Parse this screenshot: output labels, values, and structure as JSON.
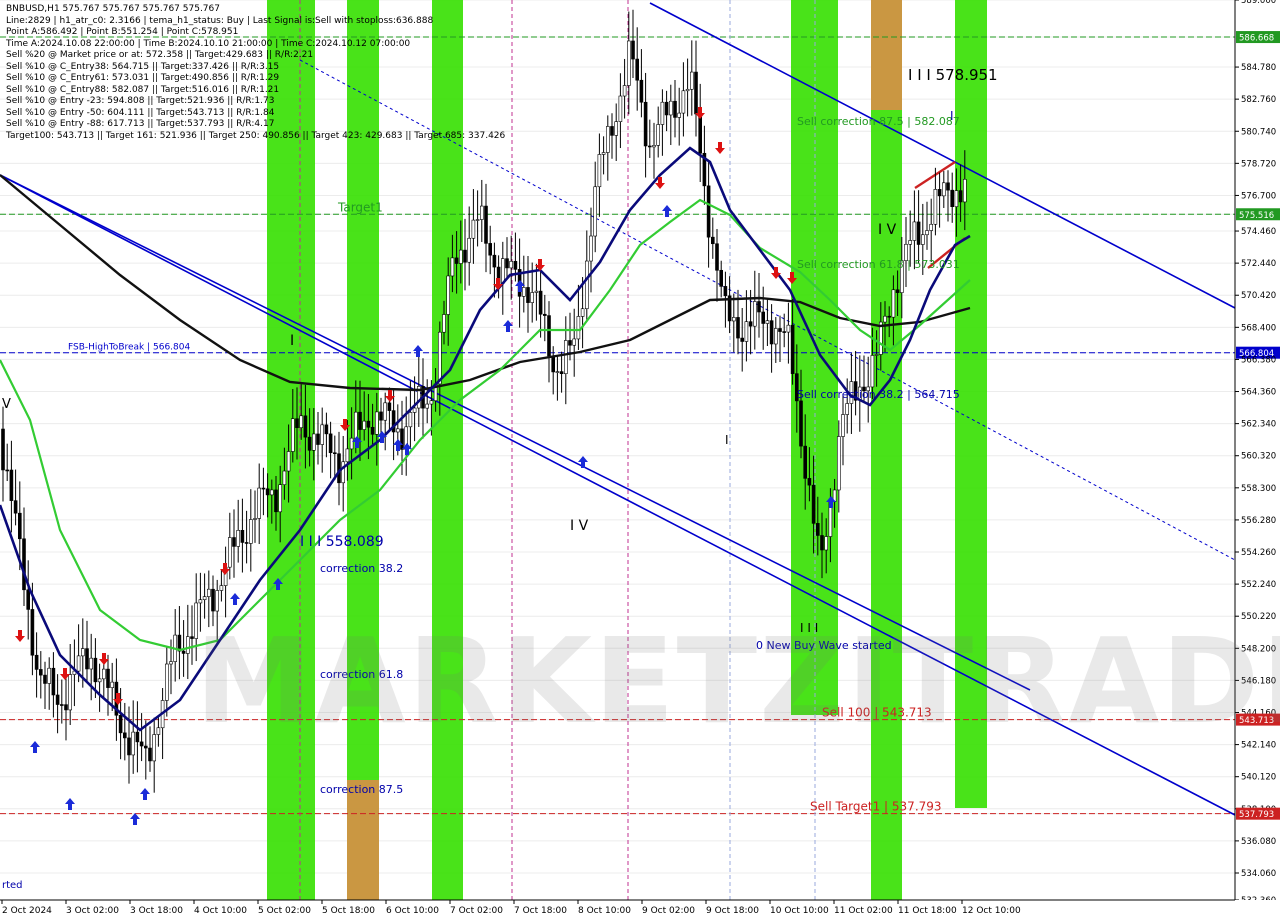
{
  "info_lines": [
    "BNBUSD,H1  575.767 575.767 575.767 575.767",
    "Line:2829  |  h1_atr_c0: 2.3166  |  tema_h1_status: Buy  |  Last Signal is:Sell with stoploss:636.888",
    "Point A:586.492  |  Point B:551.254  |  Point C:578.951",
    "Time A:2024.10.08 22:00:00  |  Time B:2024.10.10 21:00:00  |  Time C:2024.10.12 07:00:00",
    "Sell %20 @ Market price or at: 572.358  ||  Target:429.683  ||  R/R:2.21",
    "Sell %10 @ C_Entry38: 564.715  ||  Target:337.426  ||  R/R:3.15",
    "Sell %10 @ C_Entry61: 573.031  ||  Target:490.856  ||  R/R:1.29",
    "Sell %10 @ C_Entry88: 582.087  ||  Target:516.016  ||  R/R:1.21",
    "Sell %10 @ Entry -23: 594.808  ||  Target:521.936  ||  R/R:1.73",
    "Sell %10 @ Entry -50: 604.111  ||  Target:543.713  ||  R/R:1.84",
    "Sell %10 @ Entry -88: 617.713  ||  Target:537.793  ||  R/R:4.17",
    "Target100: 543.713  ||  Target 161: 521.936  ||  Target 250: 490.856  ||  Target 423: 429.683  ||  Target 685: 337.426"
  ],
  "watermark": "MARKETZITRADE",
  "colors": {
    "green_band": "#35e000",
    "orange_band": "#e08a4a",
    "blue_line": "#0000cc",
    "navy_ma": "#0a0a7a",
    "green_ma": "#33cc33",
    "black_ma": "#111111",
    "red": "#cc2222",
    "grid": "#ececec"
  },
  "chart_data": {
    "type": "candlestick",
    "symbol": "BNBUSD,H1",
    "ylim": [
      532.36,
      589.0
    ],
    "price_ticks": [
      "589.000",
      "586.668",
      "584.780",
      "582.760",
      "580.740",
      "578.720",
      "576.700",
      "575.516",
      "574.460",
      "572.440",
      "570.420",
      "568.400",
      "566.804",
      "566.380",
      "564.360",
      "562.340",
      "560.320",
      "558.300",
      "556.280",
      "554.260",
      "552.240",
      "550.220",
      "548.200",
      "546.180",
      "544.160",
      "543.713",
      "542.140",
      "540.120",
      "538.100",
      "537.793",
      "536.080",
      "534.060",
      "532.360"
    ],
    "time_labels": [
      "2 Oct 2024",
      "3 Oct 02:00",
      "3 Oct 18:00",
      "4 Oct 10:00",
      "5 Oct 02:00",
      "5 Oct 18:00",
      "6 Oct 10:00",
      "7 Oct 02:00",
      "7 Oct 18:00",
      "8 Oct 10:00",
      "9 Oct 02:00",
      "9 Oct 18:00",
      "10 Oct 10:00",
      "11 Oct 02:00",
      "11 Oct 18:00",
      "12 Oct 10:00"
    ],
    "horizontal_levels": [
      {
        "label": "FSB-HighToBreak | 566.804",
        "price": 566.804,
        "color": "#0000cc",
        "badge": "566.804"
      },
      {
        "label": "",
        "price": 586.668,
        "color": "#229922",
        "badge": "586.668"
      },
      {
        "label": "Target1",
        "price": 575.516,
        "color": "#229922",
        "badge": "575.516"
      },
      {
        "label": "Sell 100 | 543.713",
        "price": 543.713,
        "color": "#cc2222",
        "badge": "543.713"
      },
      {
        "label": "Sell Target1 | 537.793",
        "price": 537.793,
        "color": "#cc2222",
        "badge": "537.793"
      }
    ],
    "annotations": [
      "I I I 578.951",
      "Sell correction 87.5 | 582.087",
      "Sell correction 61.8 | 573.031",
      "Sell correction 38.2 | 564.715",
      "0 New Buy Wave started",
      "I I I 558.089",
      "correction 38.2",
      "correction 61.8",
      "correction 87.5",
      "I V",
      "I V",
      "I",
      "I",
      "I",
      "I I I",
      "V",
      "rted"
    ]
  }
}
